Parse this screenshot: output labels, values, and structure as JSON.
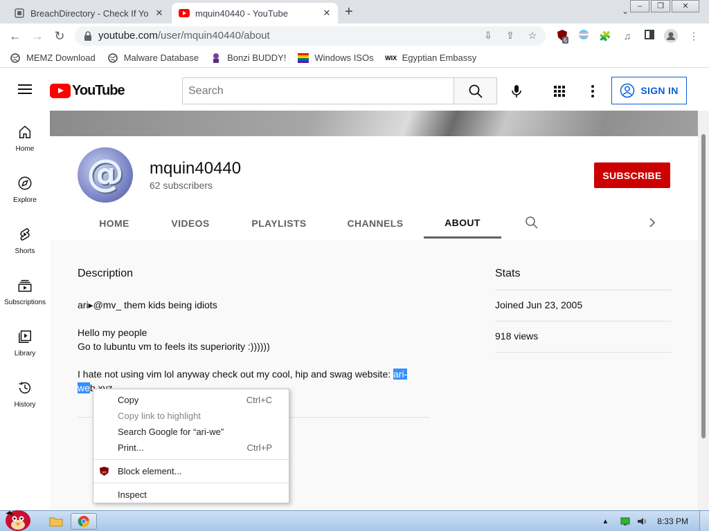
{
  "browser": {
    "tabs": [
      {
        "title": "BreachDirectory - Check If You",
        "active": false
      },
      {
        "title": "mquin40440 - YouTube",
        "active": true
      }
    ],
    "url_host": "youtube.com",
    "url_path": "/user/mquin40440/about",
    "extension_badge": "6",
    "bookmarks": [
      {
        "label": "MEMZ Download",
        "icon": "globe-icon"
      },
      {
        "label": "Malware Database",
        "icon": "globe-icon"
      },
      {
        "label": "Bonzi BUDDY!",
        "icon": "bonzi-icon"
      },
      {
        "label": "Windows ISOs",
        "icon": "rainbow-flag-icon"
      },
      {
        "label": "Egyptian Embassy",
        "icon": "wix-icon"
      }
    ]
  },
  "youtube": {
    "logo_text": "YouTube",
    "search_placeholder": "Search",
    "sign_in": "SIGN IN",
    "guide": [
      "Home",
      "Explore",
      "Shorts",
      "Subscriptions",
      "Library",
      "History"
    ]
  },
  "channel": {
    "name": "mquin40440",
    "subscribers": "62 subscribers",
    "subscribe_label": "SUBSCRIBE",
    "tabs": [
      "HOME",
      "VIDEOS",
      "PLAYLISTS",
      "CHANNELS",
      "ABOUT"
    ],
    "active_tab": "ABOUT"
  },
  "about": {
    "description_heading": "Description",
    "line1": "ari▸@mv_ them kids being idiots",
    "line2": "Hello my people",
    "line3": "Go to lubuntu vm to feels its superiority :))))))",
    "line4_prefix": "I hate not using vim lol anyway check out my cool, hip and swag website: ",
    "link_selected_1": "ari-",
    "link_selected_2": "we",
    "link_rest": "b.xyz",
    "stats_heading": "Stats",
    "joined": "Joined Jun 23, 2005",
    "views": "918 views"
  },
  "context_menu": {
    "copy": "Copy",
    "copy_shortcut": "Ctrl+C",
    "copy_link": "Copy link to highlight",
    "search_google": "Search Google for “ari-we”",
    "print": "Print...",
    "print_shortcut": "Ctrl+P",
    "block_element": "Block element...",
    "inspect": "Inspect"
  },
  "taskbar": {
    "clock": "8:33 PM"
  },
  "colors": {
    "yt_red": "#ff0000",
    "subscribe_red": "#cc0000",
    "link_blue": "#065fd4",
    "selection_blue": "#3390ff"
  }
}
